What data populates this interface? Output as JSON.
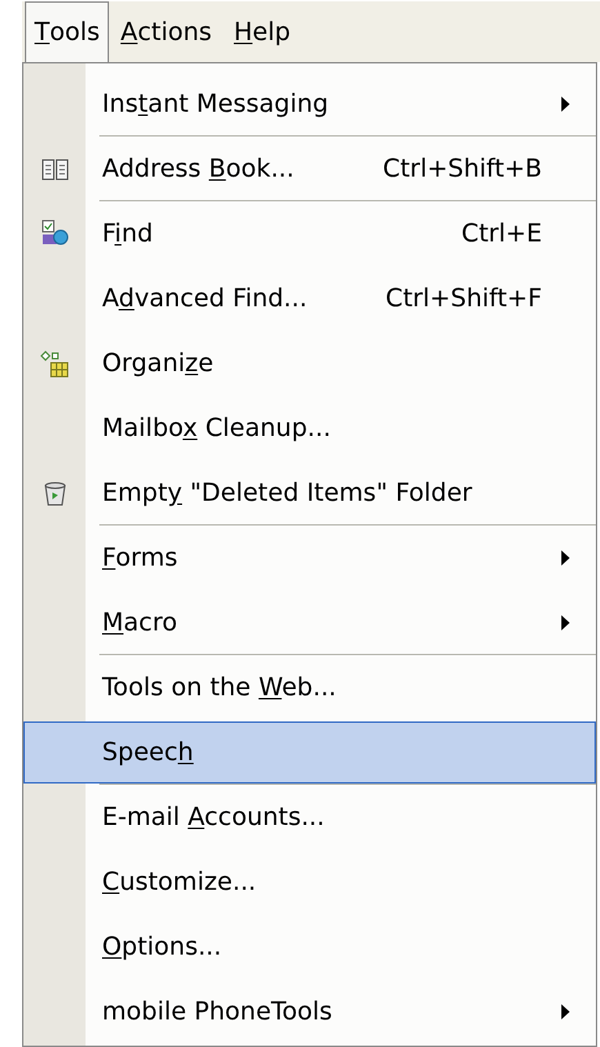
{
  "menu_bar": [
    {
      "key": "T",
      "after": "ools",
      "selected": true
    },
    {
      "key": "A",
      "after": "ctions",
      "selected": false
    },
    {
      "key": "H",
      "after": "elp",
      "selected": false
    }
  ],
  "menu": [
    {
      "kind": "plain",
      "before": "Ins",
      "key": "t",
      "after": "ant Messaging",
      "submenu": true,
      "separator_after": true,
      "selected": false
    },
    {
      "kind": "book",
      "before": "Address ",
      "key": "B",
      "after": "ook...",
      "shortcut": "Ctrl+Shift+B",
      "submenu": false,
      "separator_after": true,
      "selected": false
    },
    {
      "kind": "find",
      "before": "F",
      "key": "i",
      "after": "nd",
      "shortcut": "Ctrl+E",
      "submenu": false,
      "separator_after": false,
      "selected": false
    },
    {
      "kind": "plain",
      "before": "A",
      "key": "d",
      "after": "vanced Find...",
      "shortcut": "Ctrl+Shift+F",
      "submenu": false,
      "separator_after": false,
      "selected": false
    },
    {
      "kind": "organize",
      "before": "Organi",
      "key": "z",
      "after": "e",
      "submenu": false,
      "separator_after": false,
      "selected": false
    },
    {
      "kind": "plain",
      "before": "Mailbo",
      "key": "x",
      "after": " Cleanup...",
      "submenu": false,
      "separator_after": false,
      "selected": false
    },
    {
      "kind": "bin",
      "before": "Empt",
      "key": "y",
      "after": " \"Deleted Items\" Folder",
      "submenu": false,
      "separator_after": true,
      "selected": false
    },
    {
      "kind": "plain",
      "key": "F",
      "after": "orms",
      "submenu": true,
      "separator_after": false,
      "selected": false
    },
    {
      "kind": "plain",
      "key": "M",
      "after": "acro",
      "submenu": true,
      "separator_after": true,
      "selected": false
    },
    {
      "kind": "plain",
      "before": "Tools on the ",
      "key": "W",
      "after": "eb...",
      "submenu": false,
      "separator_after": false,
      "selected": false
    },
    {
      "kind": "plain",
      "before": "Speec",
      "key": "h",
      "submenu": false,
      "separator_after": true,
      "selected": true
    },
    {
      "kind": "plain",
      "before": "E-mail ",
      "key": "A",
      "after": "ccounts...",
      "submenu": false,
      "separator_after": false,
      "selected": false
    },
    {
      "kind": "plain",
      "key": "C",
      "after": "ustomize...",
      "submenu": false,
      "separator_after": false,
      "selected": false
    },
    {
      "kind": "plain",
      "key": "O",
      "after": "ptions...",
      "submenu": false,
      "separator_after": false,
      "selected": false
    },
    {
      "kind": "plain",
      "before": "mobile PhoneTools",
      "submenu": true,
      "separator_after": false,
      "selected": false
    }
  ]
}
